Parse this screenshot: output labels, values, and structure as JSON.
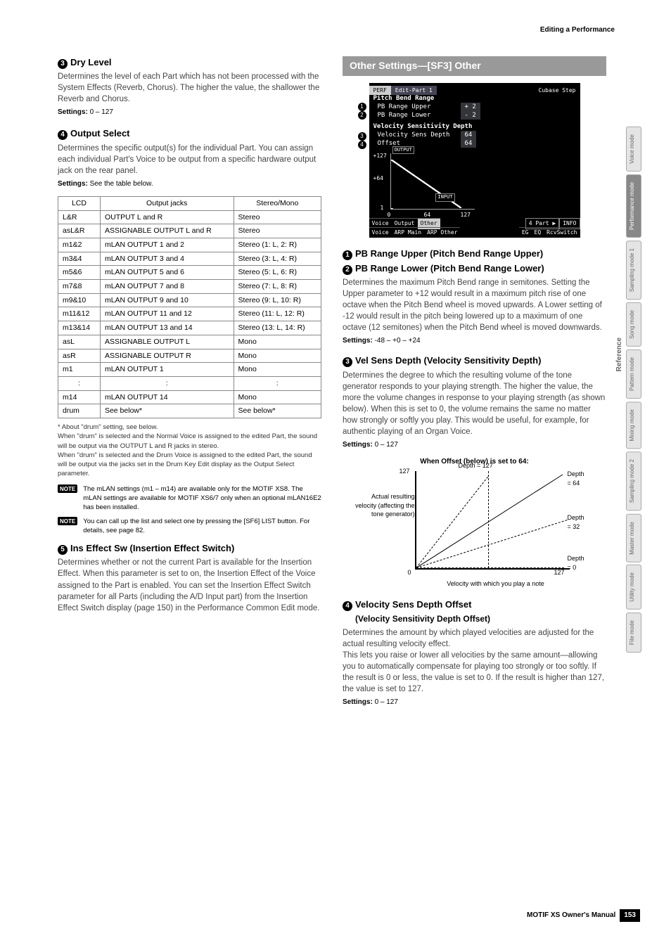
{
  "header": {
    "breadcrumb": "Editing a Performance"
  },
  "left": {
    "dry": {
      "num": "3",
      "title": "Dry Level",
      "body": "Determines the level of each Part which has not been processed with the System Effects (Reverb, Chorus). The higher the value, the shallower the Reverb and Chorus.",
      "settings_lbl": "Settings:",
      "settings_val": "0 – 127"
    },
    "output": {
      "num": "4",
      "title": "Output Select",
      "body": "Determines the specific output(s) for the individual Part. You can assign each individual Part's Voice to be output from a specific hardware output jack on the rear panel.",
      "settings_lbl": "Settings:",
      "settings_val": "See the table below.",
      "table": {
        "headers": [
          "LCD",
          "Output jacks",
          "Stereo/Mono"
        ],
        "rows": [
          [
            "L&R",
            "OUTPUT L and R",
            "Stereo"
          ],
          [
            "asL&R",
            "ASSIGNABLE OUTPUT L and R",
            "Stereo"
          ],
          [
            "m1&2",
            "mLAN OUTPUT 1 and 2",
            "Stereo (1: L, 2: R)"
          ],
          [
            "m3&4",
            "mLAN OUTPUT 3 and 4",
            "Stereo (3: L, 4: R)"
          ],
          [
            "m5&6",
            "mLAN OUTPUT 5 and 6",
            "Stereo (5: L, 6: R)"
          ],
          [
            "m7&8",
            "mLAN OUTPUT 7 and 8",
            "Stereo (7: L, 8: R)"
          ],
          [
            "m9&10",
            "mLAN OUTPUT 9 and 10",
            "Stereo (9: L, 10: R)"
          ],
          [
            "m11&12",
            "mLAN OUTPUT 11 and 12",
            "Stereo (11: L, 12: R)"
          ],
          [
            "m13&14",
            "mLAN OUTPUT 13 and 14",
            "Stereo (13: L, 14: R)"
          ],
          [
            "asL",
            "ASSIGNABLE OUTPUT L",
            "Mono"
          ],
          [
            "asR",
            "ASSIGNABLE OUTPUT R",
            "Mono"
          ],
          [
            "m1",
            "mLAN OUTPUT 1",
            "Mono"
          ],
          [
            ":",
            ":",
            ":"
          ],
          [
            "m14",
            "mLAN OUTPUT 14",
            "Mono"
          ],
          [
            "drum",
            "See below*",
            "See below*"
          ]
        ]
      },
      "footnote": "* About \"drum\" setting, see below.\nWhen \"drum\" is selected and the Normal Voice is assigned to the edited Part, the sound will be output via the OUTPUT L and R jacks in stereo.\nWhen \"drum\" is selected and the Drum Voice is assigned to the edited Part, the sound will be output via the jacks set in the Drum Key Edit display as the Output Select parameter.",
      "note1_tag": "NOTE",
      "note1": "The mLAN settings (m1 – m14) are available only for the MOTIF XS8. The mLAN settings are available for MOTIF XS6/7 only when an optional mLAN16E2 has been installed.",
      "note2_tag": "NOTE",
      "note2": "You can call up the list and select one by pressing the [SF6] LIST button. For details, see page 82."
    },
    "ins": {
      "num": "5",
      "title": "Ins Effect Sw (Insertion Effect Switch)",
      "body": "Determines whether or not the current Part is available for the Insertion Effect. When this parameter is set to on, the Insertion Effect of the Voice assigned to the Part is enabled. You can set the Insertion Effect Switch parameter for all Parts (including the A/D Input part) from the Insertion Effect Switch display (page 150) in the Performance Common Edit mode."
    }
  },
  "right": {
    "bar_title": "Other Settings—[SF3] Other",
    "screenshot": {
      "perf": "PERF",
      "edit": "Edit-Part 1",
      "cubase": "Cubase Step",
      "sec1": "Pitch Bend Range",
      "r1": "PB Range Upper",
      "v1": "+ 2",
      "r2": "PB Range Lower",
      "v2": "- 2",
      "sec2": "Velocity Sensitivity Depth",
      "r3": "Velocity Sens Depth",
      "v3": "64",
      "r4": "Offset",
      "v4": "64",
      "ylabel_top": "+127",
      "ylabel_mid": "+64",
      "ylabel_bot": "1",
      "gbox_out": "OUTPUT",
      "gbox_in": "INPUT",
      "x0": "0",
      "x64": "64",
      "x127": "127",
      "bot_voice": "Voice",
      "bot_output": "Output",
      "bot_other": "Other",
      "bot_4part": "4 Part ▶",
      "bot_info": "INFO",
      "b2_voice": "Voice",
      "b2_arpmain": "ARP Main",
      "b2_arpother": "ARP Other",
      "b2_eg": "EG",
      "b2_eq": "EQ",
      "b2_rcv": "RcvSwitch",
      "c1": "1",
      "c2": "2",
      "c3": "3",
      "c4": "4"
    },
    "pb": {
      "num1": "1",
      "title1": "PB Range Upper (Pitch Bend Range Upper)",
      "num2": "2",
      "title2": "PB Range Lower (Pitch Bend Range Lower)",
      "body": "Determines the maximum Pitch Bend range in semitones. Setting the Upper parameter to +12 would result in a maximum pitch rise of one octave when the Pitch Bend wheel is moved upwards. A Lower setting of -12 would result in the pitch being lowered up to a maximum of one octave (12 semitones) when the Pitch Bend wheel is moved downwards.",
      "settings_lbl": "Settings:",
      "settings_val": "-48 – +0 – +24"
    },
    "vsd": {
      "num": "3",
      "title": "Vel Sens Depth (Velocity Sensitivity Depth)",
      "body": "Determines the degree to which the resulting volume of the tone generator responds to your playing strength. The higher the value, the more the volume changes in response to your playing strength (as shown below). When this is set to 0, the volume remains the same no matter how strongly or softly you play. This would be useful, for example, for authentic playing of an Organ Voice.",
      "settings_lbl": "Settings:",
      "settings_val": "0 – 127",
      "chart_title": "When Offset (below) is set to 64:",
      "ylabel": "Actual resulting velocity (affecting the tone generator)",
      "xlabel": "Velocity with which you play a note",
      "y127": "127",
      "y0": "0",
      "x127": "127",
      "d127": "Depth = 127",
      "d64": "Depth = 64",
      "d32": "Depth = 32",
      "d0": "Depth = 0"
    },
    "vsdo": {
      "num": "4",
      "title": "Velocity Sens Depth Offset",
      "subtitle": "(Velocity Sensitivity Depth Offset)",
      "body": "Determines the amount by which played velocities are adjusted for the actual resulting velocity effect.\nThis lets you raise or lower all velocities by the same amount—allowing you to automatically compensate for playing too strongly or too softly. If the result is 0 or less, the value is set to 0. If the result is higher than 127, the value is set to 127.",
      "settings_lbl": "Settings:",
      "settings_val": "0 – 127"
    }
  },
  "chart_data": {
    "type": "line",
    "title": "When Offset (below) is set to 64:",
    "xlabel": "Velocity with which you play a note",
    "ylabel": "Actual resulting velocity (affecting the tone generator)",
    "xlim": [
      0,
      127
    ],
    "ylim": [
      0,
      127
    ],
    "series": [
      {
        "name": "Depth = 127",
        "x": [
          0,
          64
        ],
        "y": [
          0,
          127
        ],
        "style": "dashed"
      },
      {
        "name": "Depth = 64",
        "x": [
          0,
          127
        ],
        "y": [
          0,
          127
        ],
        "style": "solid"
      },
      {
        "name": "Depth = 32",
        "x": [
          0,
          127
        ],
        "y": [
          0,
          64
        ],
        "style": "dashed"
      },
      {
        "name": "Depth = 0",
        "x": [
          0,
          127
        ],
        "y": [
          0,
          0
        ],
        "style": "dashed"
      }
    ]
  },
  "sidetabs": [
    "Voice mode",
    "Performance mode",
    "Sampling mode 1",
    "Song mode",
    "Pattern mode",
    "Mixing mode",
    "Sampling mode 2",
    "Master mode",
    "Utility mode",
    "File mode"
  ],
  "side_ref": "Reference",
  "footer": {
    "manual": "MOTIF XS Owner's Manual",
    "page": "153"
  }
}
